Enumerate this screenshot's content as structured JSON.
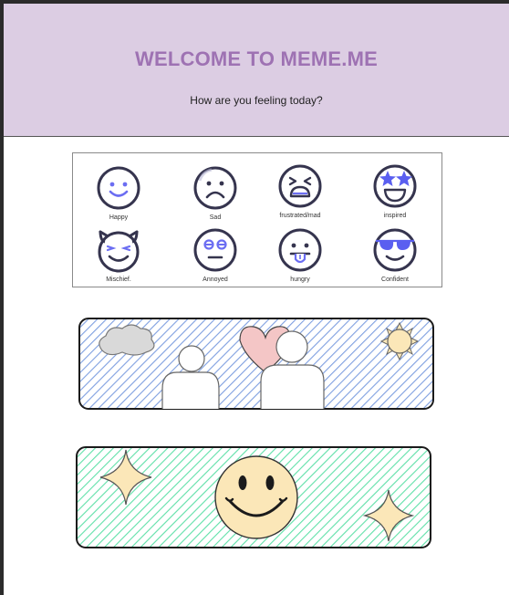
{
  "header": {
    "title": "WELCOME TO MEME.ME",
    "subtitle": "How are you feeling today?",
    "background": "#dccde3",
    "title_color": "#9e72b3"
  },
  "moods": [
    {
      "label": "Happy",
      "icon": "happy-face-icon"
    },
    {
      "label": "Sad",
      "icon": "sad-face-icon"
    },
    {
      "label": "frustrated/mad",
      "icon": "frustrated-face-icon"
    },
    {
      "label": "inspired",
      "icon": "star-eyes-face-icon"
    },
    {
      "label": "Mischief.",
      "icon": "devil-face-icon"
    },
    {
      "label": "Annoyed",
      "icon": "annoyed-face-icon"
    },
    {
      "label": "hungry",
      "icon": "tongue-face-icon"
    },
    {
      "label": "Confident",
      "icon": "sunglasses-face-icon"
    }
  ],
  "colors": {
    "icon_stroke": "#35344e",
    "icon_accent": "#6b6df2",
    "banner1_hatch": "#7e9fe0",
    "banner2_hatch": "#5fe0a8",
    "heart": "#f4c6c6",
    "sun": "#fbe7b8",
    "cloud": "#d9d9d9"
  },
  "banners": [
    {
      "name": "love-banner",
      "icons": [
        "cloud-icon",
        "heart-icon",
        "sun-icon",
        "person-icon"
      ]
    },
    {
      "name": "smile-banner",
      "icons": [
        "sparkle-icon",
        "smiley-icon"
      ]
    }
  ]
}
